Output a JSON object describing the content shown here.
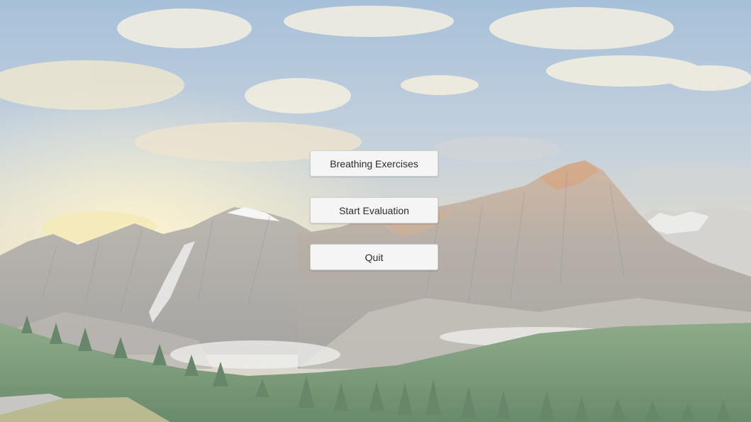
{
  "menu": {
    "breathing_label": "Breathing Exercises",
    "evaluation_label": "Start Evaluation",
    "quit_label": "Quit"
  },
  "background": {
    "scene": "mountain-landscape",
    "colors": {
      "sky_top": "#8fb0cf",
      "sky_bottom": "#d9d3c0",
      "mountain": "#9a9690",
      "forest": "#4f7a4c",
      "haze": "#e6e6e3"
    }
  }
}
